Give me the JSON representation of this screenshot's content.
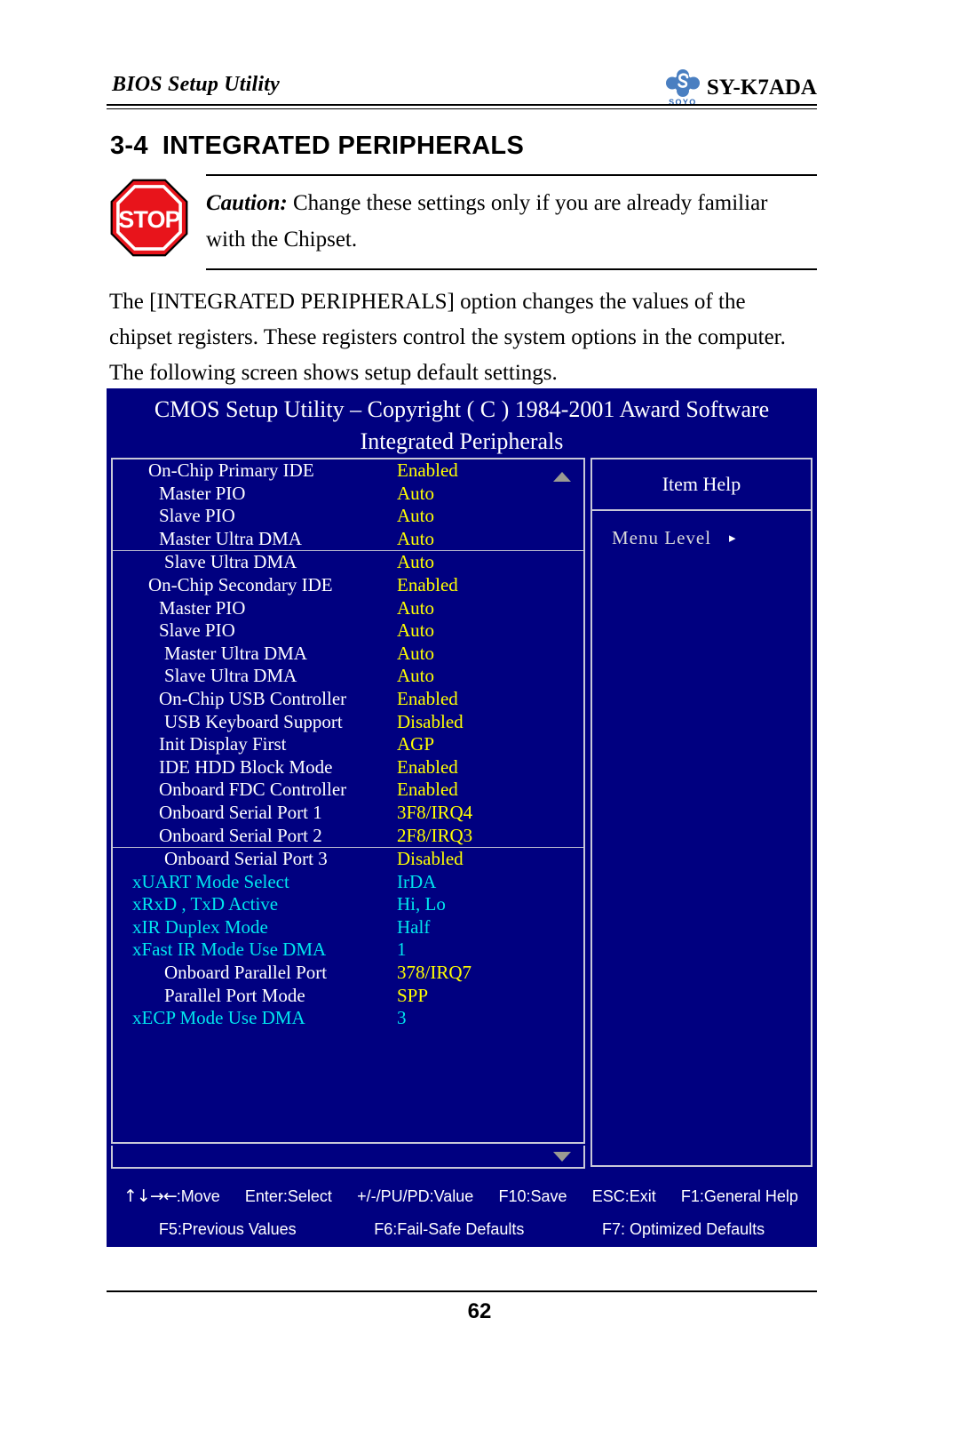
{
  "header": {
    "title": "BIOS Setup Utility",
    "model": "SY-K7ADA",
    "logo_icon": "soyo-logo-icon",
    "logo_word": "SOYO"
  },
  "section": {
    "number": "3-4",
    "title": "INTEGRATED PERIPHERALS"
  },
  "caution": {
    "icon": "stop-sign-icon",
    "sign_text": "STOP",
    "label": "Caution:",
    "line1": " Change these settings only if you are already familiar",
    "line2": "with the Chipset."
  },
  "intro": {
    "line1": "The [INTEGRATED PERIPHERALS] option changes the values of the",
    "line2": "chipset registers. These registers control the system options in the computer.",
    "line3": "The following screen shows setup default settings."
  },
  "bios": {
    "title_line1": "CMOS Setup Utility – Copyright ( C ) 1984-2001 Award Software",
    "title_line2": "Integrated Peripherals",
    "scroll_up_icon": "scroll-up-arrow-icon",
    "scroll_down_icon": "scroll-down-arrow-icon",
    "items": [
      {
        "label": "On-Chip Primary IDE",
        "value": "Enabled",
        "indent": 0,
        "color": "white",
        "sep_after": false
      },
      {
        "label": "Master PIO",
        "value": "Auto",
        "indent": 1,
        "color": "white",
        "sep_after": false
      },
      {
        "label": "Slave PIO",
        "value": "Auto",
        "indent": 1,
        "color": "white",
        "sep_after": false
      },
      {
        "label": "Master Ultra DMA",
        "value": "Auto",
        "indent": 1,
        "color": "white",
        "sep_after": true
      },
      {
        "label": "Slave Ultra DMA",
        "value": "Auto",
        "indent": 2,
        "color": "white",
        "sep_after": false
      },
      {
        "label": "On-Chip Secondary IDE",
        "value": "Enabled",
        "indent": 0,
        "color": "white",
        "sep_after": false
      },
      {
        "label": "Master PIO",
        "value": "Auto",
        "indent": 1,
        "color": "white",
        "sep_after": false
      },
      {
        "label": "Slave PIO",
        "value": "Auto",
        "indent": 1,
        "color": "white",
        "sep_after": false
      },
      {
        "label": "Master Ultra DMA",
        "value": "Auto",
        "indent": 2,
        "color": "white",
        "sep_after": false
      },
      {
        "label": "Slave Ultra DMA",
        "value": "Auto",
        "indent": 2,
        "color": "white",
        "sep_after": false
      },
      {
        "label": "On-Chip USB Controller",
        "value": "Enabled",
        "indent": 1,
        "color": "white",
        "sep_after": false
      },
      {
        "label": "USB Keyboard Support",
        "value": "Disabled",
        "indent": 2,
        "color": "white",
        "sep_after": false
      },
      {
        "label": "Init Display First",
        "value": "AGP",
        "indent": 1,
        "color": "white",
        "sep_after": false
      },
      {
        "label": "IDE HDD Block Mode",
        "value": "Enabled",
        "indent": 1,
        "color": "white",
        "sep_after": false
      },
      {
        "label": "Onboard FDC Controller",
        "value": "Enabled",
        "indent": 1,
        "color": "white",
        "sep_after": false
      },
      {
        "label": "Onboard Serial Port 1",
        "value": "3F8/IRQ4",
        "indent": 1,
        "color": "white",
        "sep_after": false
      },
      {
        "label": "Onboard Serial Port 2",
        "value": "2F8/IRQ3",
        "indent": 1,
        "color": "white",
        "sep_after": true
      },
      {
        "label": "Onboard Serial Port 3",
        "value": "Disabled",
        "indent": 2,
        "color": "white",
        "sep_after": false
      },
      {
        "label": "xUART Mode Select",
        "value": "IrDA",
        "indent": 3,
        "color": "cyan",
        "sep_after": false
      },
      {
        "label": "xRxD , TxD Active",
        "value": "Hi, Lo",
        "indent": 3,
        "color": "cyan",
        "sep_after": false
      },
      {
        "label": "xIR Duplex Mode",
        "value": "Half",
        "indent": 3,
        "color": "cyan",
        "sep_after": false
      },
      {
        "label": "xFast IR Mode Use DMA",
        "value": "1",
        "indent": 3,
        "color": "cyan",
        "sep_after": false
      },
      {
        "label": "Onboard Parallel Port",
        "value": "378/IRQ7",
        "indent": 2,
        "color": "white",
        "sep_after": false
      },
      {
        "label": "Parallel Port Mode",
        "value": "SPP",
        "indent": 2,
        "color": "white",
        "sep_after": false
      },
      {
        "label": "xECP Mode Use DMA",
        "value": "3",
        "indent": 3,
        "color": "cyan",
        "sep_after": false
      }
    ],
    "help": {
      "title": "Item Help",
      "menu_level_label": "Menu Level",
      "menu_level_caret": "▸"
    },
    "keys_row1": [
      {
        "glyphs": "↑↓→←",
        "text": ":Move"
      },
      {
        "glyphs": "",
        "text": "Enter:Select"
      },
      {
        "glyphs": "",
        "text": "+/-/PU/PD:Value"
      },
      {
        "glyphs": "",
        "text": "F10:Save"
      },
      {
        "glyphs": "",
        "text": "ESC:Exit"
      },
      {
        "glyphs": "",
        "text": "F1:General Help"
      }
    ],
    "keys_row2": [
      {
        "text": "F5:Previous Values"
      },
      {
        "text": "F6:Fail-Safe Defaults"
      },
      {
        "text": "F7: Optimized Defaults"
      }
    ]
  },
  "footer": {
    "page_number": "62"
  },
  "colors": {
    "bios_bg": "#000080",
    "value_yellow": "#ffff00",
    "disabled_cyan": "#00e5ee",
    "panel_border": "#c8c8d8",
    "stop_red": "#e8141b",
    "logo_blue": "#2b66b5"
  }
}
